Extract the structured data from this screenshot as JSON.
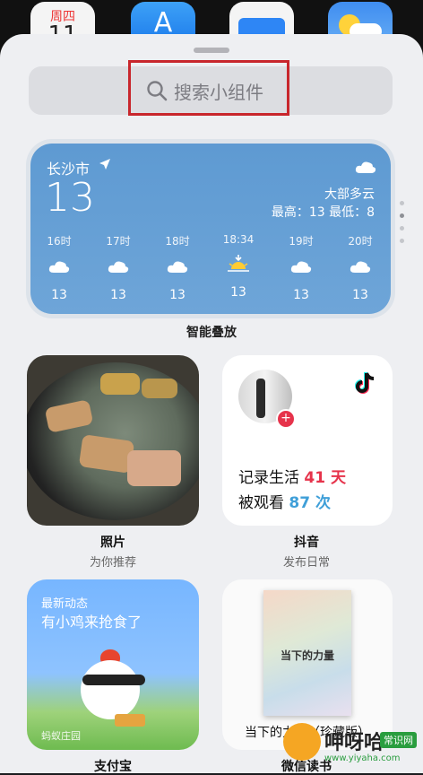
{
  "dock": {
    "calendar": {
      "weekday": "周四",
      "day": "11"
    },
    "appstore_icon": "appstore-icon",
    "files_icon": "folder-icon",
    "weather_icon": "weather-icon"
  },
  "search": {
    "placeholder": "搜索小组件",
    "icon": "search-icon"
  },
  "weather": {
    "city": "长沙市",
    "temp": "13",
    "condition": "大部多云",
    "hilo": "最高：13 最低：8",
    "hours": [
      {
        "time": "16时",
        "icon": "cloud",
        "temp": "13"
      },
      {
        "time": "17时",
        "icon": "cloud",
        "temp": "13"
      },
      {
        "time": "18时",
        "icon": "cloud",
        "temp": "13"
      },
      {
        "time": "18:34",
        "icon": "sunset",
        "temp": "13"
      },
      {
        "time": "19时",
        "icon": "cloud",
        "temp": "13"
      },
      {
        "time": "20时",
        "icon": "cloud",
        "temp": "13"
      }
    ]
  },
  "stack_label": "智能叠放",
  "widgets": {
    "photos": {
      "name": "照片",
      "subtitle": "为你推荐"
    },
    "douyin": {
      "name": "抖音",
      "subtitle": "发布日常",
      "line1_pre": "记录生活 ",
      "line1_num": "41 天",
      "line2_pre": "被观看 ",
      "line2_num": "87 次"
    },
    "alipay": {
      "name": "支付宝",
      "subtitle": "",
      "label": "最新动态",
      "message": "有小鸡来抢食了",
      "brand": "蚂蚁庄园"
    },
    "books": {
      "name": "微信读书",
      "subtitle": "",
      "cover_title": "当下的力量",
      "book_title": "当下的力量（珍藏版）"
    }
  },
  "watermark": {
    "text": "呷呀哈",
    "badge": "常识网",
    "url": "www.yiyaha.com"
  },
  "colors": {
    "accent_red": "#c8262c",
    "douyin_red": "#e6334b",
    "douyin_blue": "#3f9fd8"
  }
}
